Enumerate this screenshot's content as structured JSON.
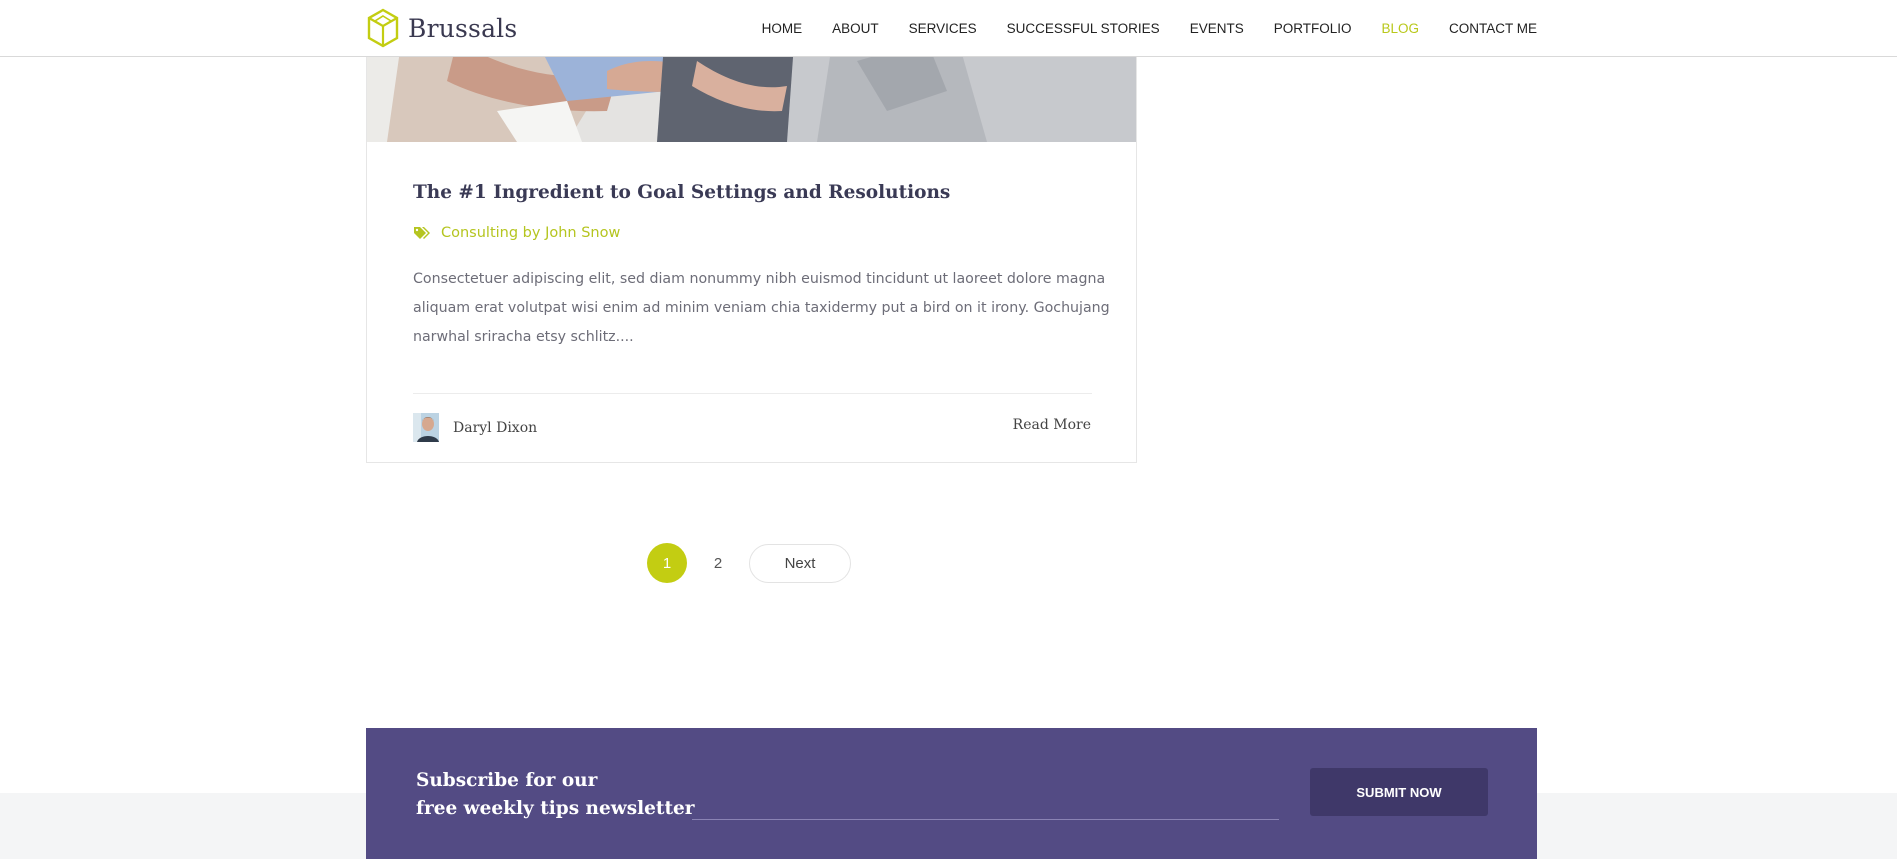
{
  "header": {
    "logo_text": "Brussals",
    "nav": [
      {
        "label": "HOME",
        "active": false
      },
      {
        "label": "ABOUT",
        "active": false
      },
      {
        "label": "SERVICES",
        "active": false
      },
      {
        "label": "SUCCESSFUL STORIES",
        "active": false
      },
      {
        "label": "EVENTS",
        "active": false
      },
      {
        "label": "PORTFOLIO",
        "active": false
      },
      {
        "label": "BLOG",
        "active": true
      },
      {
        "label": "CONTACT ME",
        "active": false
      }
    ]
  },
  "post": {
    "title": "The #1 Ingredient to Goal Settings and Resolutions",
    "category": "Consulting by John Snow",
    "excerpt": "Consectetuer adipiscing elit, sed diam nonummy nibh euismod tincidunt ut laoreet dolore magna aliquam erat volutpat wisi enim ad minim veniam chia taxidermy put a bird on it irony. Gochujang narwhal sriracha etsy schlitz....",
    "author": "Daryl Dixon",
    "read_more": "Read More"
  },
  "pagination": {
    "pages": [
      "1",
      "2"
    ],
    "current": "1",
    "next_label": "Next"
  },
  "newsletter": {
    "line1": "Subscribe for our",
    "line2": "free weekly tips newsletter",
    "input_value": "",
    "submit_label": "SUBMIT NOW"
  },
  "colors": {
    "accent": "#c3cd12",
    "newsletter_bg": "#534b84",
    "submit_bg": "#3f3869",
    "title": "#3a3a55"
  },
  "icons": {
    "logo": "hexagon-cube-icon",
    "category": "tags-icon"
  }
}
